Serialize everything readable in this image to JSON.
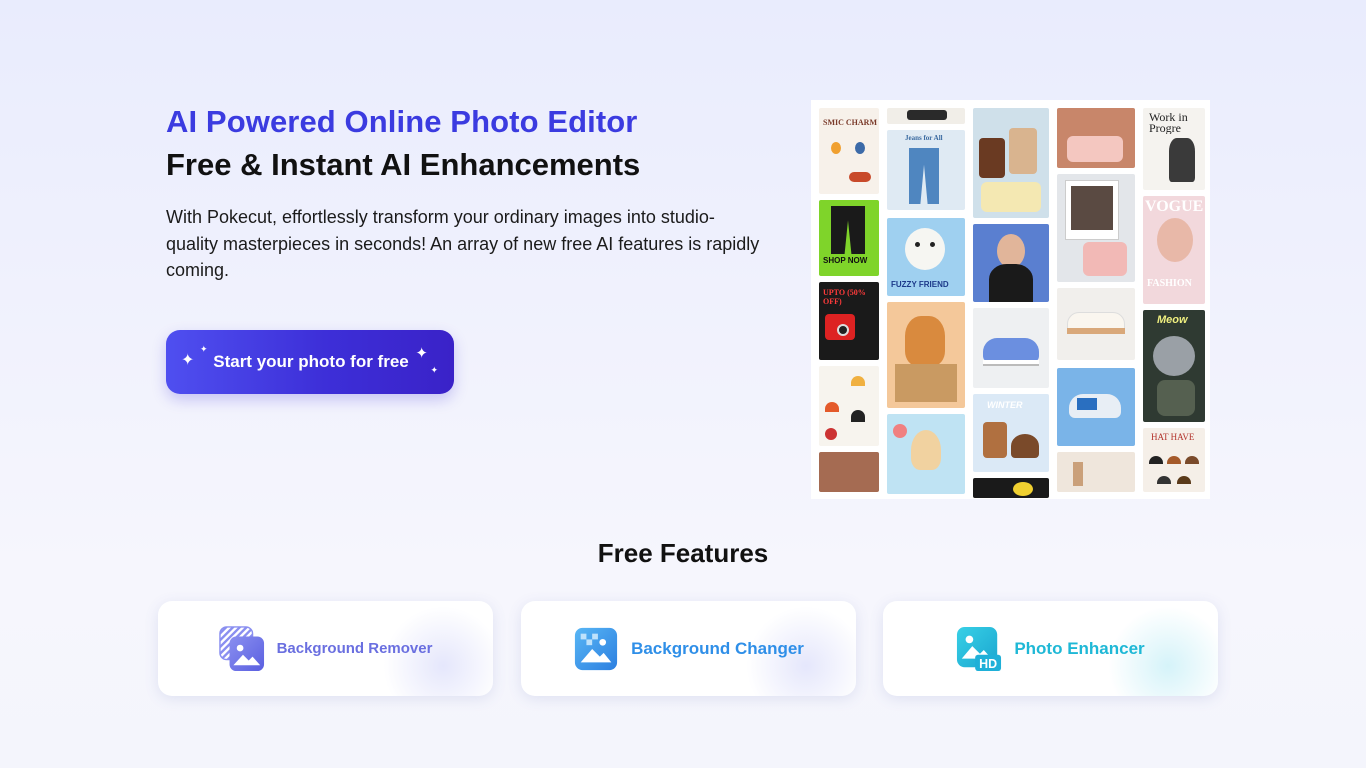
{
  "hero": {
    "title": "AI Powered Online Photo Editor",
    "subtitle": "Free & Instant AI Enhancements",
    "description": "With Pokecut, effortlessly transform your ordinary images into studio-quality masterpieces in seconds! An array of new free AI features is rapidly coming.",
    "cta_label": "Start your photo for free"
  },
  "collage": {
    "labels": {
      "cosmic": "SMIC CHARMS",
      "jeans": "Jeans for All",
      "work": "Work in Progre",
      "shop": "SHOP NOW",
      "sale": "UPTO (50% OFF)",
      "fuzzy": "FUZZY FRIEND",
      "vogue": "VOGUE",
      "fashion": "FASHION",
      "winter": "WINTER",
      "hat": "HAT HAVE",
      "meow": "Meow"
    }
  },
  "features": {
    "title": "Free Features",
    "items": [
      {
        "label": "Background Remover",
        "color": "#6a6fe0",
        "icon": "background-remover-icon"
      },
      {
        "label": "Background Changer",
        "color": "#2f8fe8",
        "icon": "background-changer-icon"
      },
      {
        "label": "Photo Enhancer",
        "color": "#1fb8d6",
        "icon": "photo-enhancer-icon"
      }
    ]
  },
  "colors": {
    "accent": "#3b3be0",
    "cta_gradient_start": "#4f4ff0",
    "cta_gradient_end": "#3a22c8"
  }
}
